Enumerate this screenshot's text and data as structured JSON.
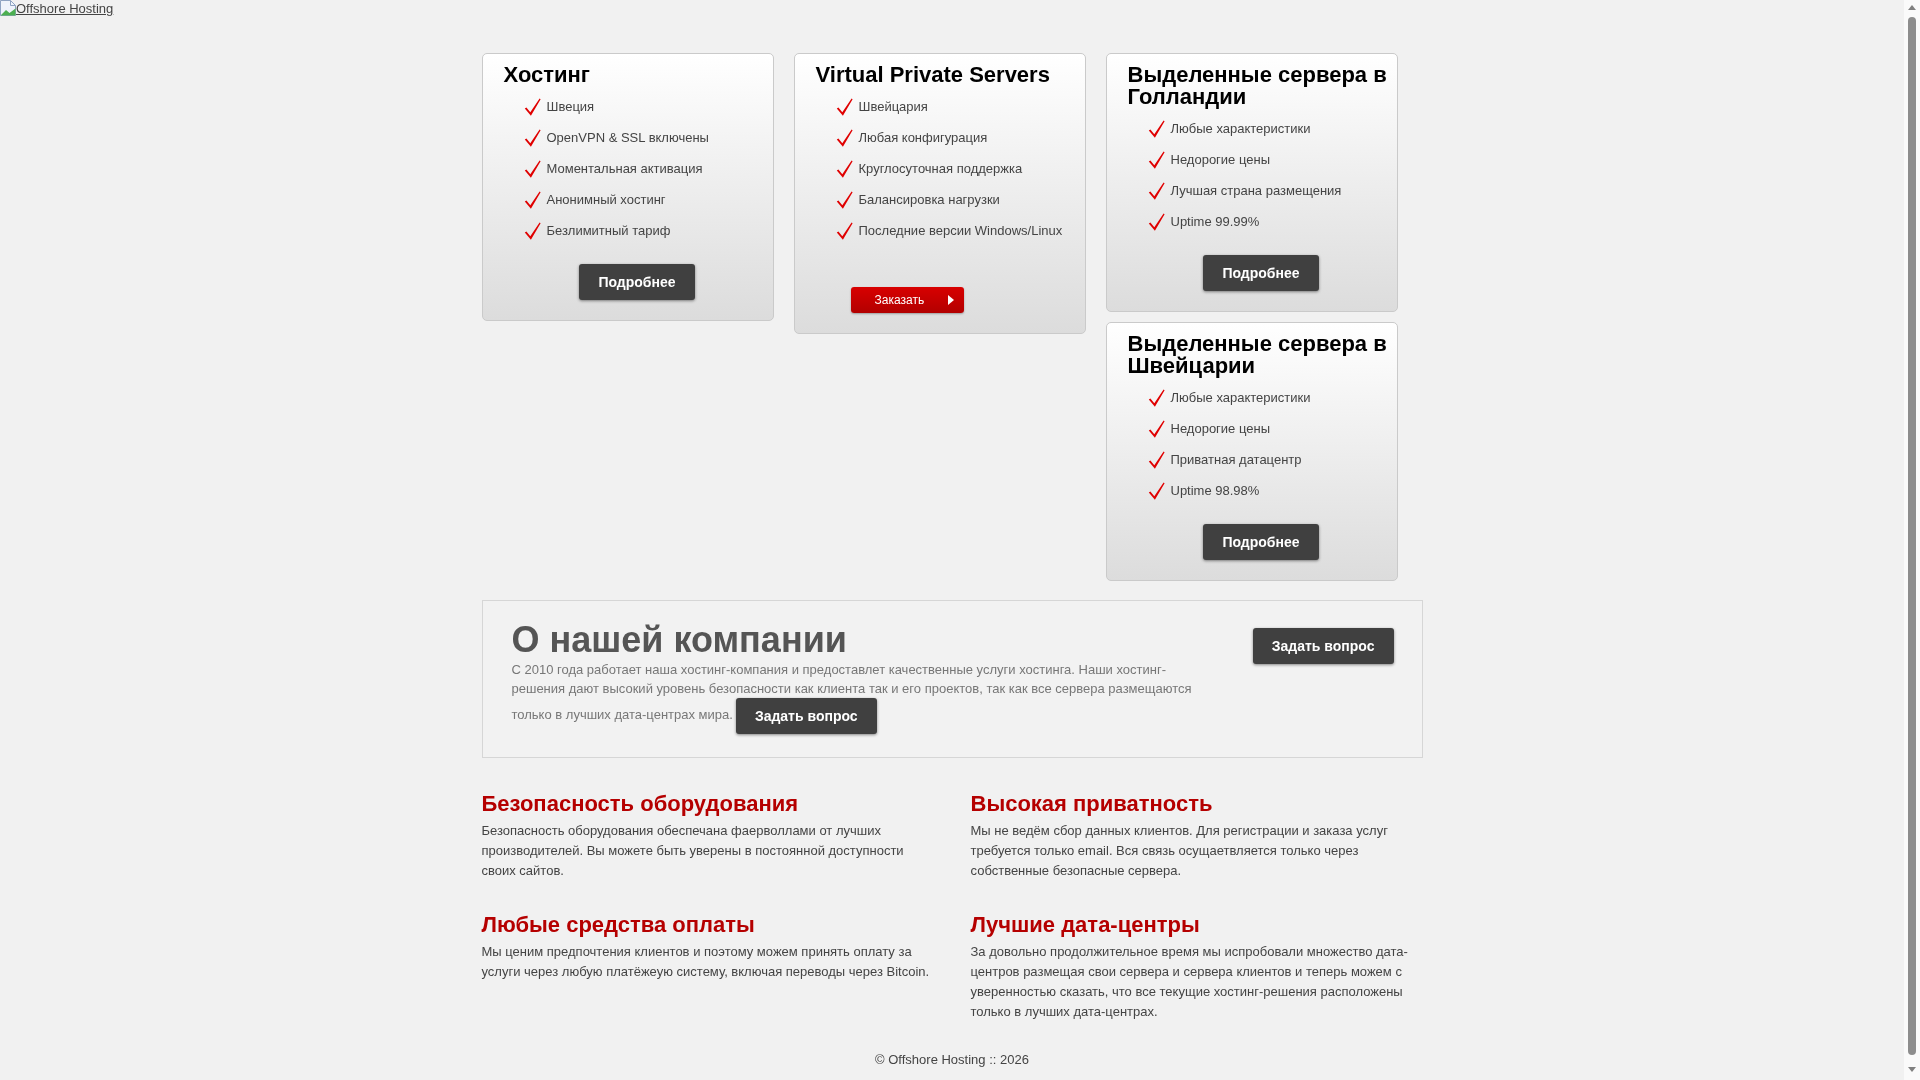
{
  "header": {
    "logo_link": "Offshore Hosting"
  },
  "plans": [
    {
      "title": "Хостинг",
      "items": [
        "Швеция",
        "OpenVPN & SSL включены",
        "Моментальная активация",
        "Анонимный хостинг",
        "Безлимитный тариф"
      ],
      "button": {
        "kind": "details",
        "label": "Подробнее"
      }
    },
    {
      "title": "Virtual Private Servers",
      "items": [
        "Швейцария",
        "Любая конфигурация",
        "Круглосуточная поддержка",
        "Балансировка нагрузки",
        "Последние версии Windows/Linux"
      ],
      "button": {
        "kind": "order",
        "label": "Заказать"
      }
    },
    {
      "title": "Выделенные сервера в Голландии",
      "items": [
        "Любые характеристики",
        "Недорогие цены",
        "Лучшая страна размещения",
        "Uptime 99.99%"
      ],
      "button": {
        "kind": "details",
        "label": "Подробнее"
      }
    },
    {
      "title": "Выделенные сервера в Швейцарии",
      "items": [
        "Любые характеристики",
        "Недорогие цены",
        "Приватная датацентр",
        "Uptime 98.98%"
      ],
      "button": {
        "kind": "details",
        "label": "Подробнее"
      }
    }
  ],
  "about": {
    "title": "О нашей компании",
    "side_button": "Задать вопрос",
    "text": "С 2010 года работает наша хостинг-компания и предоставлет качественные услуги хостинга. Наши хостинг-решения дают высокий уровень безопасности как клиента так и его проектов, так как все сервера размещаются только в лучших дата-центрах мира.",
    "inline_button": "Задать вопрос"
  },
  "features": [
    {
      "title": "Безопасность оборудования",
      "text": "Безопасность оборудования обеспечана фаерволлами от лучших производителей. Вы можете быть уверены в постоянной доступности своих сайтов."
    },
    {
      "title": "Высокая приватность",
      "text": "Мы не ведём сбор данных клиентов. Для регистрации и заказа услуг требуется только email. Вся связь осущаетвляется только через собственные безопасные сервера."
    },
    {
      "title": "Любые средства оплаты",
      "text": "Мы ценим предпочтения клиентов и поэтому можем принять оплату за услуги через любую платёжеую систему, включая переводы через Bitcoin."
    },
    {
      "title": "Лучшие дата-центры",
      "text": "За довольно продолжительное время мы испробовали множество дата-центров размещая свои сервера и сервера клиентов и теперь можем с уверенностью сказать, что все текущие хостинг-решения расположены только в лучших дата-центрах."
    }
  ],
  "footer": "© Offshore Hosting :: 2026"
}
